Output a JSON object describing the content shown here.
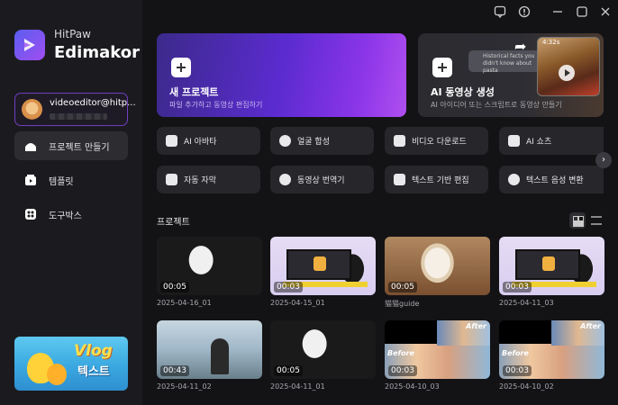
{
  "app": {
    "brand_small": "HitPaw",
    "brand_big": "Edimakor"
  },
  "account": {
    "name": "videoeditor@hitp..."
  },
  "nav": [
    {
      "label": "프로젝트 만들기",
      "icon": "home-icon",
      "active": true
    },
    {
      "label": "템플릿",
      "icon": "template-icon",
      "active": false
    },
    {
      "label": "도구박스",
      "icon": "toolbox-icon",
      "active": false
    }
  ],
  "promo": {
    "title": "Vlog",
    "subtitle": "텍스트"
  },
  "titlebar": {
    "icons": [
      "feedback-icon",
      "upgrade-icon",
      "minimize-icon",
      "maximize-icon",
      "close-icon"
    ]
  },
  "new_project": {
    "title": "새 프로젝트",
    "subtitle": "파일 추가하고 동영상 편집하기"
  },
  "ai_video": {
    "title": "AI 동영상 생성",
    "subtitle": "AI 아이디어 또는 스크립트로 동영상 만들기",
    "bubble": "Historical facts you didn't know about pasta",
    "time": "4:32s"
  },
  "tools": [
    {
      "label": "AI 아바타",
      "icon": "avatar-icon"
    },
    {
      "label": "얼굴 합성",
      "icon": "face-swap-icon"
    },
    {
      "label": "비디오 다운로드",
      "icon": "download-icon"
    },
    {
      "label": "AI 쇼츠",
      "icon": "ai-shorts-icon"
    },
    {
      "label": "자동 자막",
      "icon": "subtitle-icon"
    },
    {
      "label": "동영상 번역기",
      "icon": "translate-icon"
    },
    {
      "label": "텍스트 기반 편집",
      "icon": "text-edit-icon"
    },
    {
      "label": "텍스트 음성 변환",
      "icon": "tts-icon"
    }
  ],
  "projects_title": "프로젝트",
  "projects": [
    {
      "name": "2025-04-16_01",
      "duration": "00:05"
    },
    {
      "name": "2025-04-15_01",
      "duration": "00:03"
    },
    {
      "name": "猫猫guide",
      "duration": "00:05"
    },
    {
      "name": "2025-04-11_03",
      "duration": "00:03"
    },
    {
      "name": "2025-04-11_02",
      "duration": "00:43"
    },
    {
      "name": "2025-04-11_01",
      "duration": "00:05"
    },
    {
      "name": "2025-04-10_03",
      "duration": "00:03",
      "before": "Before",
      "after": "After"
    },
    {
      "name": "2025-04-10_02",
      "duration": "00:03",
      "before": "Before",
      "after": "After"
    }
  ]
}
